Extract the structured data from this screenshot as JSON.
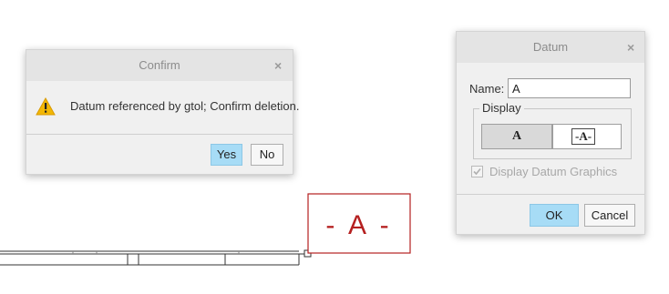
{
  "confirm_dialog": {
    "title": "Confirm",
    "message": "Datum referenced by gtol; Confirm deletion.",
    "yes_label": "Yes",
    "no_label": "No",
    "close_glyph": "×"
  },
  "datum_dialog": {
    "title": "Datum",
    "close_glyph": "×",
    "name_label": "Name:",
    "name_value": "A",
    "display_group_label": "Display",
    "display_option_plain": "A",
    "display_option_framed": "-A-",
    "display_graphics_label": "Display Datum Graphics",
    "display_graphics_checked": true,
    "ok_label": "OK",
    "cancel_label": "Cancel"
  },
  "drawing": {
    "datum_label": "- A -",
    "datum_color": "#b52020"
  },
  "colors": {
    "accent_button": "#a7dcf6",
    "warning_icon": "#f2b705"
  },
  "icons": [
    "warning-icon",
    "close-icon",
    "checkbox-checked-icon"
  ]
}
